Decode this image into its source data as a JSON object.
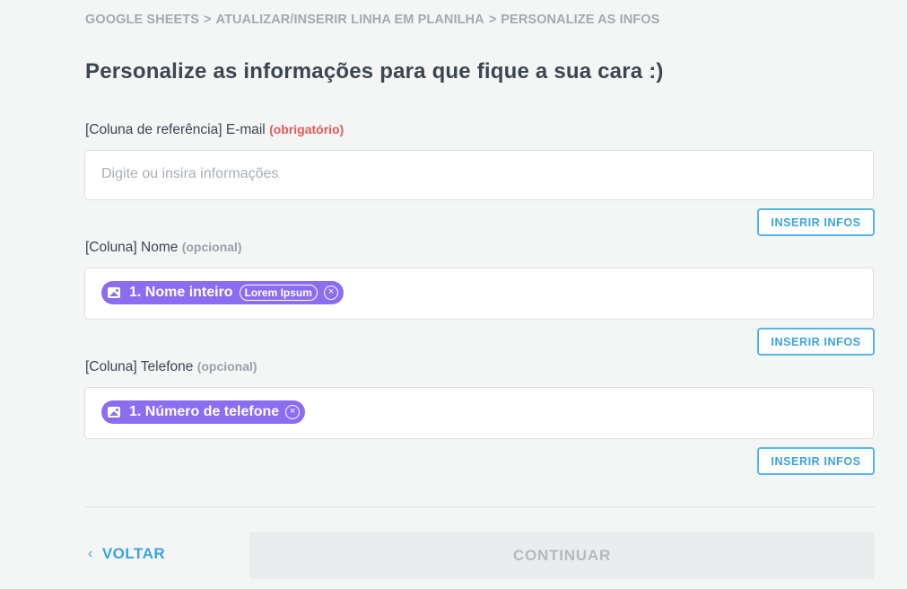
{
  "breadcrumb": {
    "items": [
      "GOOGLE SHEETS",
      "ATUALIZAR/INSERIR LINHA EM PLANILHA",
      "PERSONALIZE AS INFOS"
    ],
    "separator": ">"
  },
  "page_title": "Personalize as informações para que fique a sua cara :)",
  "fields": [
    {
      "label": "[Coluna de referência] E-mail",
      "tag": "(obrigatório)",
      "placeholder": "Digite ou insira informações",
      "insert_label": "INSERIR INFOS"
    },
    {
      "label": "[Coluna] Nome",
      "tag": "(opcional)",
      "pill": {
        "text": "1. Nome inteiro",
        "sample": "Lorem Ipsum",
        "remove": "×",
        "icon": "image-icon"
      },
      "insert_label": "INSERIR INFOS"
    },
    {
      "label": "[Coluna] Telefone",
      "tag": "(opcional)",
      "pill": {
        "text": "1. Número de telefone",
        "remove": "×",
        "icon": "image-icon"
      },
      "insert_label": "INSERIR INFOS"
    }
  ],
  "footer": {
    "back_label": "VOLTAR",
    "back_icon": "‹",
    "continue_label": "CONTINUAR"
  },
  "colors": {
    "accent": "#3aa3dd",
    "pill": "#8a6df0",
    "required": "#e05a5a"
  }
}
